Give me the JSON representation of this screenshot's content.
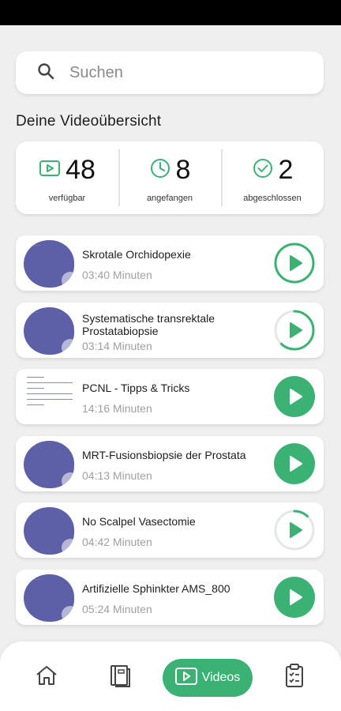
{
  "search": {
    "placeholder": "Suchen"
  },
  "overview_title": "Deine Videoübersicht",
  "stats": [
    {
      "value": "48",
      "label": "verfügbar",
      "icon": "video-icon"
    },
    {
      "value": "8",
      "label": "angefangen",
      "icon": "clock-icon"
    },
    {
      "value": "2",
      "label": "abgeschlossen",
      "icon": "check-circle-icon"
    }
  ],
  "videos": [
    {
      "title": "Skrotale Orchidopexie",
      "duration": "03:40 Minuten",
      "progress": 0.0,
      "state": "outline"
    },
    {
      "title": "Systematische transrektale Prostatabiopsie",
      "duration": "03:14 Minuten",
      "progress": 0.62,
      "state": "partial"
    },
    {
      "title": "PCNL - Tipps & Tricks",
      "duration": "14:16 Minuten",
      "progress": 1.0,
      "state": "filled"
    },
    {
      "title": "MRT-Fusionsbiopsie der Prostata",
      "duration": "04:13 Minuten",
      "progress": 1.0,
      "state": "filled"
    },
    {
      "title": "No Scalpel Vasectomie",
      "duration": "04:42 Minuten",
      "progress": 0.12,
      "state": "partial"
    },
    {
      "title": "Artifizielle Sphinkter AMS_800",
      "duration": "05:24 Minuten",
      "progress": 1.0,
      "state": "filled"
    }
  ],
  "nav": {
    "active_label": "Videos",
    "items": [
      "home-icon",
      "book-icon",
      "video-icon",
      "clipboard-icon"
    ]
  },
  "colors": {
    "accent": "#3bb273",
    "thumb": "#5d5fa7",
    "background": "#efefef"
  }
}
